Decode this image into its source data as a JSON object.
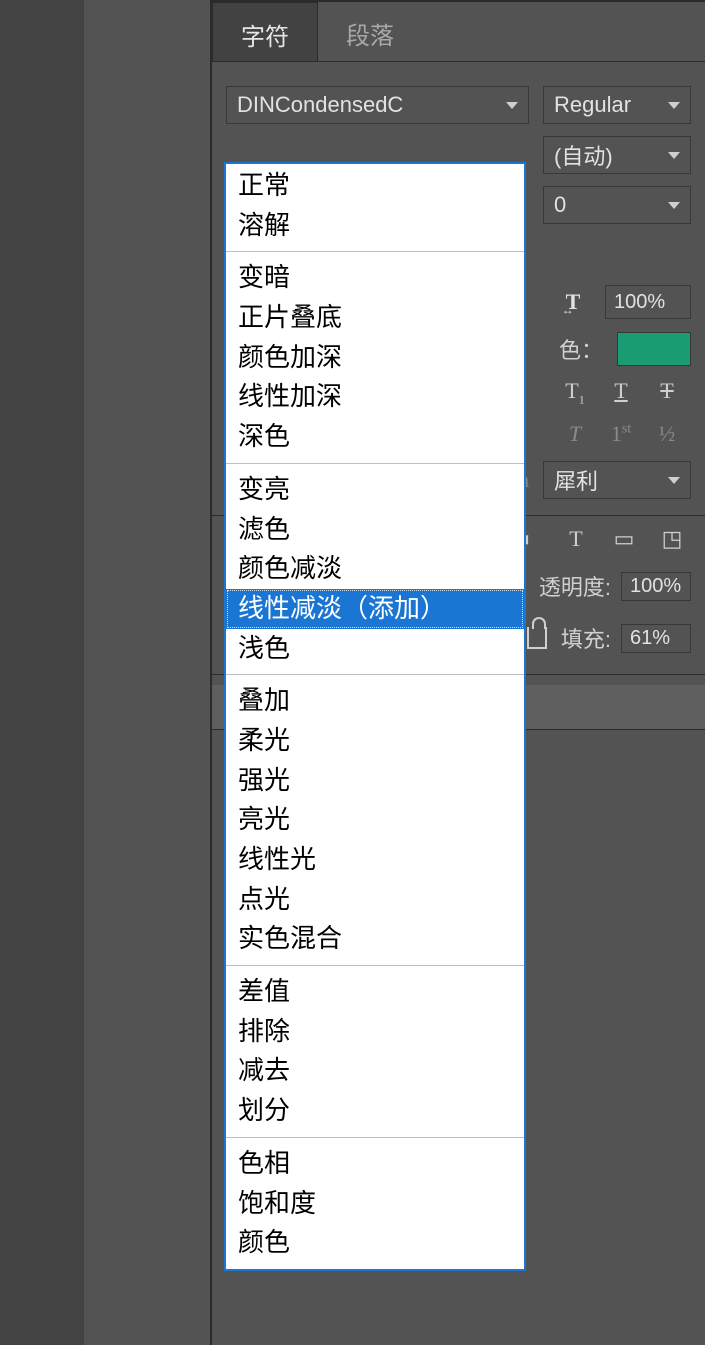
{
  "tabs": {
    "character": "字符",
    "paragraph": "段落"
  },
  "font": {
    "family": "DINCondensedC",
    "style": "Regular",
    "leading": "(自动)",
    "tracking": "0",
    "scale_h": "100%",
    "color_label": "色：",
    "color_hex": "#199b74",
    "aa": "犀利"
  },
  "type_icons": {
    "t1_sub": "1",
    "t_base": "T",
    "t_strike": "T",
    "italic": "T",
    "ordinal": "1",
    "ordinal_sup": "st",
    "fraction": "½"
  },
  "layers": {
    "opacity_label": "透明度:",
    "opacity_value": "100%",
    "fill_label": "填充:",
    "fill_value": "61%"
  },
  "blend_modes": {
    "group1": [
      "正常",
      "溶解"
    ],
    "group2": [
      "变暗",
      "正片叠底",
      "颜色加深",
      "线性加深",
      "深色"
    ],
    "group3": [
      "变亮",
      "滤色",
      "颜色减淡",
      "线性减淡（添加）",
      "浅色"
    ],
    "group4": [
      "叠加",
      "柔光",
      "强光",
      "亮光",
      "线性光",
      "点光",
      "实色混合"
    ],
    "group5": [
      "差值",
      "排除",
      "减去",
      "划分"
    ],
    "group6": [
      "色相",
      "饱和度",
      "颜色"
    ]
  },
  "selected_blend": "线性减淡（添加）"
}
